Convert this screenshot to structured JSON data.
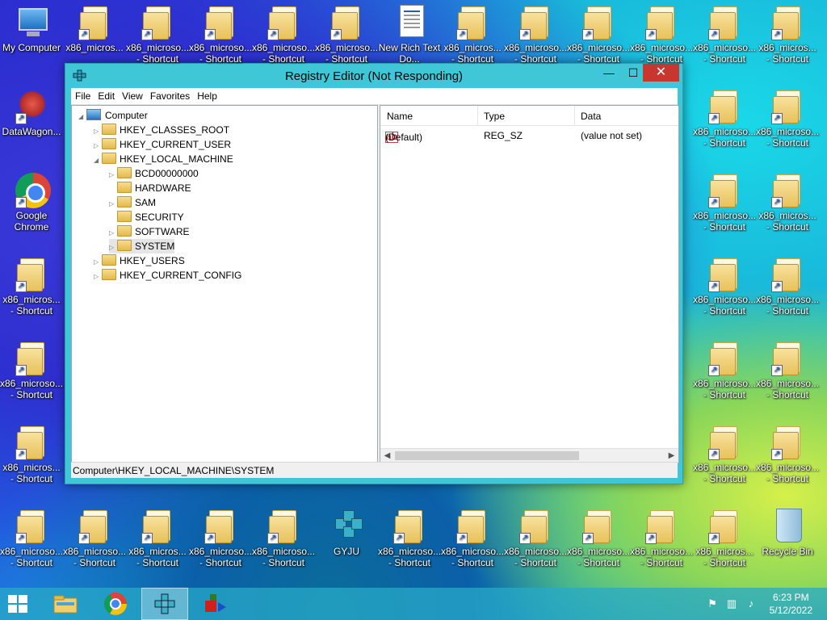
{
  "desktop": {
    "icons_top": [
      {
        "label": "My Computer"
      },
      {
        "label": "x86_micros..."
      },
      {
        "label": "x86_microso... - Shortcut"
      },
      {
        "label": "x86_microso... - Shortcut"
      },
      {
        "label": "x86_microso... - Shortcut"
      },
      {
        "label": "x86_microso... - Shortcut"
      },
      {
        "label": "New Rich Text Do..."
      },
      {
        "label": "x86_micros... - Shortcut"
      },
      {
        "label": "x86_microso... - Shortcut"
      },
      {
        "label": "x86_microso... - Shortcut"
      },
      {
        "label": "x86_microso... - Shortcut"
      },
      {
        "label": "x86_microso... - Shortcut"
      },
      {
        "label": "x86_micros... - Shortcut"
      }
    ],
    "icons_left": [
      {
        "label": "DataWagon..."
      },
      {
        "label": "Google Chrome"
      },
      {
        "label": "x86_micros... - Shortcut"
      },
      {
        "label": "x86_microso... - Shortcut"
      },
      {
        "label": "x86_micros... - Shortcut"
      }
    ],
    "icons_right_col1": [
      {
        "label": "x86_microso... - Shortcut"
      },
      {
        "label": "x86_microso... - Shortcut"
      },
      {
        "label": "x86_microso... - Shortcut"
      },
      {
        "label": "x86_microso... - Shortcut"
      },
      {
        "label": "x86_microso... - Shortcut"
      }
    ],
    "icons_right_col2": [
      {
        "label": "x86_microso... - Shortcut"
      },
      {
        "label": "x86_micros... - Shortcut"
      },
      {
        "label": "x86_microso... - Shortcut"
      },
      {
        "label": "x86_microso... - Shortcut"
      },
      {
        "label": "x86_microso... - Shortcut"
      }
    ],
    "icons_bottom": [
      {
        "label": "x86_microso... - Shortcut",
        "kind": "folder"
      },
      {
        "label": "x86_microso... - Shortcut",
        "kind": "folder"
      },
      {
        "label": "x86_micros... - Shortcut",
        "kind": "folder"
      },
      {
        "label": "x86_microso... - Shortcut",
        "kind": "folder"
      },
      {
        "label": "x86_microso... - Shortcut",
        "kind": "folder"
      },
      {
        "label": "GYJU",
        "kind": "regedit"
      },
      {
        "label": "x86_microso... - Shortcut",
        "kind": "folder"
      },
      {
        "label": "x86_microso... - Shortcut",
        "kind": "folder"
      },
      {
        "label": "x86_microso... - Shortcut",
        "kind": "folder"
      },
      {
        "label": "x86_microso... - Shortcut",
        "kind": "folder"
      },
      {
        "label": "x86_microso... - Shortcut",
        "kind": "folder"
      },
      {
        "label": "x86_micros... - Shortcut",
        "kind": "folder"
      },
      {
        "label": "Recycle Bin",
        "kind": "recycle-bin"
      }
    ]
  },
  "window": {
    "title": "Registry Editor (Not Responding)",
    "minimize_glyph": "—",
    "maximize_glyph": "☐",
    "close_glyph": "✕",
    "menu": [
      "File",
      "Edit",
      "View",
      "Favorites",
      "Help"
    ],
    "tree": [
      {
        "label": "Computer",
        "level": 0,
        "expanded": true,
        "icon": "computer-icon"
      },
      {
        "label": "HKEY_CLASSES_ROOT",
        "level": 1,
        "expanded": false
      },
      {
        "label": "HKEY_CURRENT_USER",
        "level": 1,
        "expanded": false
      },
      {
        "label": "HKEY_LOCAL_MACHINE",
        "level": 1,
        "expanded": true
      },
      {
        "label": "BCD00000000",
        "level": 2,
        "expanded": false
      },
      {
        "label": "HARDWARE",
        "level": 2,
        "leaf": true
      },
      {
        "label": "SAM",
        "level": 2,
        "expanded": false
      },
      {
        "label": "SECURITY",
        "level": 2,
        "leaf": true
      },
      {
        "label": "SOFTWARE",
        "level": 2,
        "expanded": false
      },
      {
        "label": "SYSTEM",
        "level": 2,
        "expanded": false,
        "selected": true
      },
      {
        "label": "HKEY_USERS",
        "level": 1,
        "expanded": false
      },
      {
        "label": "HKEY_CURRENT_CONFIG",
        "level": 1,
        "expanded": false
      }
    ],
    "list_headers": {
      "name": "Name",
      "type": "Type",
      "data": "Data"
    },
    "list_rows": [
      {
        "name": "(Default)",
        "type": "REG_SZ",
        "data": "(value not set)"
      }
    ],
    "status": "Computer\\HKEY_LOCAL_MACHINE\\SYSTEM"
  },
  "taskbar": {
    "time": "6:23 PM",
    "date": "5/12/2022"
  },
  "colors": {
    "window_frame": "#3fc7d8",
    "close_button": "#c7372f",
    "taskbar": "#28aac8"
  }
}
